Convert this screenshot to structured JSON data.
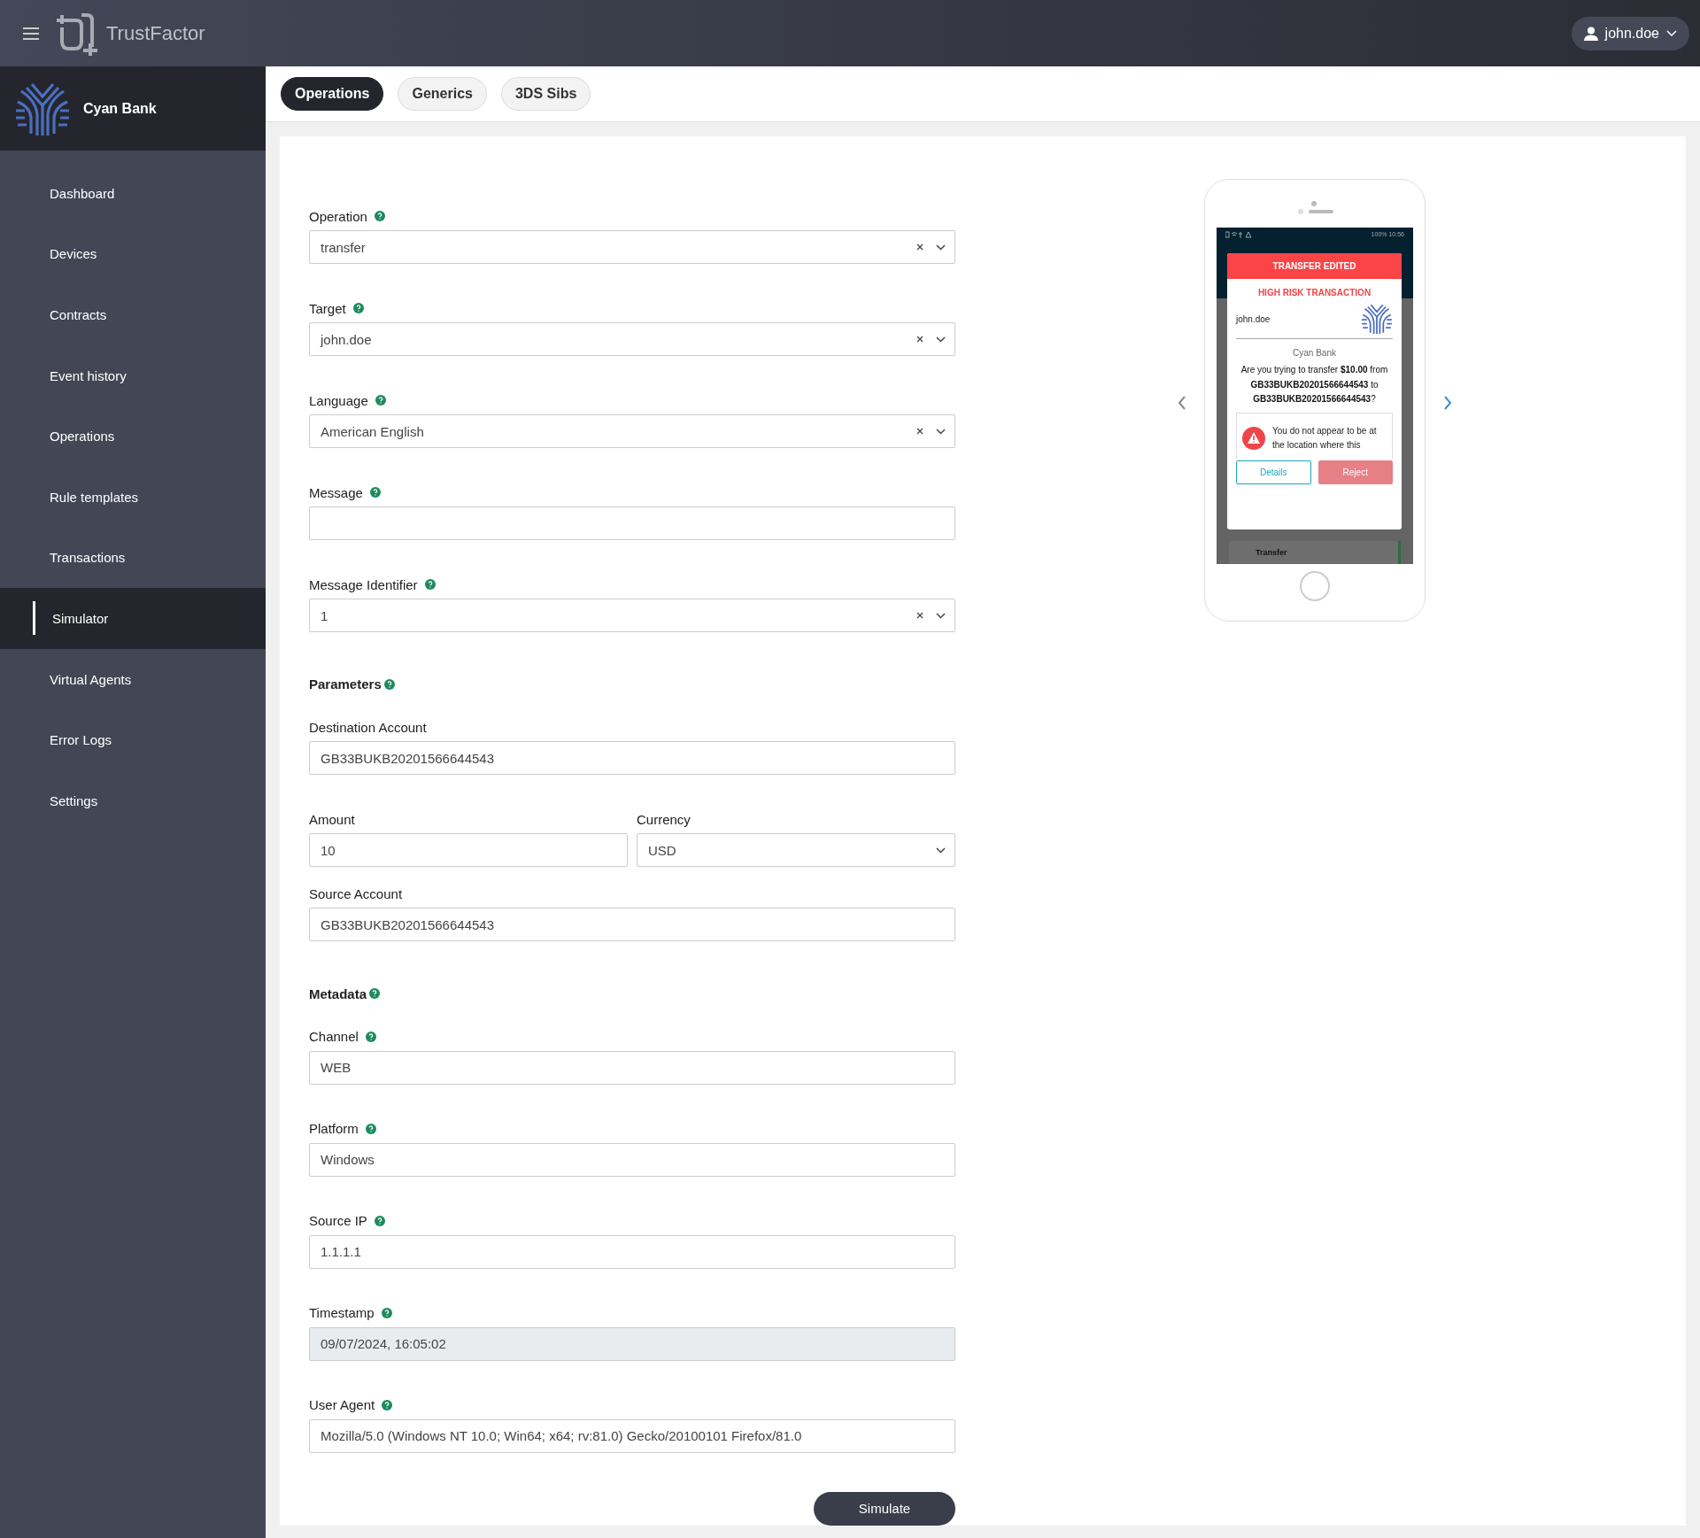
{
  "header": {
    "app_name": "TrustFactor",
    "user": "john.doe"
  },
  "sidebar": {
    "org_name": "Cyan Bank",
    "items": [
      {
        "label": "Dashboard",
        "selected": false
      },
      {
        "label": "Devices",
        "selected": false
      },
      {
        "label": "Contracts",
        "selected": false
      },
      {
        "label": "Event history",
        "selected": false
      },
      {
        "label": "Operations",
        "selected": false
      },
      {
        "label": "Rule templates",
        "selected": false
      },
      {
        "label": "Transactions",
        "selected": false
      },
      {
        "label": "Simulator",
        "selected": true
      },
      {
        "label": "Virtual Agents",
        "selected": false
      },
      {
        "label": "Error Logs",
        "selected": false
      },
      {
        "label": "Settings",
        "selected": false
      }
    ]
  },
  "tabs": [
    {
      "label": "Operations",
      "selected": true
    },
    {
      "label": "Generics",
      "selected": false
    },
    {
      "label": "3DS Sibs",
      "selected": false
    }
  ],
  "form": {
    "items": [
      {
        "kind": "select",
        "label": "Operation",
        "help": true,
        "value": "transfer",
        "clearable": true
      },
      {
        "kind": "select",
        "label": "Target",
        "help": true,
        "value": "john.doe",
        "clearable": true
      },
      {
        "kind": "select",
        "label": "Language",
        "help": true,
        "value": "American English",
        "clearable": true
      },
      {
        "kind": "input",
        "label": "Message",
        "help": true
      },
      {
        "kind": "select",
        "label": "Message Identifier",
        "help": true,
        "value": "1",
        "clearable": true
      },
      {
        "kind": "heading",
        "label": "Parameters",
        "help": true
      },
      {
        "kind": "input",
        "label": "Destination Account",
        "help": false,
        "value": "GB33BUKB20201566644543"
      },
      {
        "kind": "split",
        "items": [
          {
            "kind": "input",
            "label": "Amount",
            "help": false,
            "value": "10"
          },
          {
            "kind": "select",
            "label": "Currency",
            "help": false,
            "value": "USD",
            "clearable": false
          }
        ]
      },
      {
        "kind": "input",
        "label": "Source Account",
        "help": false,
        "value": "GB33BUKB20201566644543"
      },
      {
        "kind": "heading",
        "label": "Metadata",
        "help": true
      },
      {
        "kind": "input",
        "label": "Channel",
        "help": true,
        "value": "WEB"
      },
      {
        "kind": "input",
        "label": "Platform",
        "help": true,
        "value": "Windows"
      },
      {
        "kind": "input",
        "label": "Source IP",
        "help": true,
        "value": "1.1.1.1"
      },
      {
        "kind": "input",
        "label": "Timestamp",
        "help": true,
        "value": "09/07/2024, 16:05:02",
        "disabled": true
      },
      {
        "kind": "input",
        "label": "User Agent",
        "help": true,
        "value": "Mozilla/5.0 (Windows NT 10.0; Win64; x64; rv:81.0) Gecko/20100101 Firefox/81.0"
      }
    ],
    "submit": "Simulate"
  },
  "preview": {
    "battery": "100%",
    "time": "10:56",
    "banner": "TRANSFER EDITED",
    "risk": "HIGH RISK TRANSACTION",
    "user": "john.doe",
    "bank": "Cyan Bank",
    "question": "Are you trying to transfer **$10.00** from **GB33BUKB20201566644543** to **GB33BUKB20201566644543**?",
    "warning": "You do not appear to be at the location where this",
    "buttons": [
      "Details",
      "Reject"
    ],
    "background_item": "Transfer"
  }
}
